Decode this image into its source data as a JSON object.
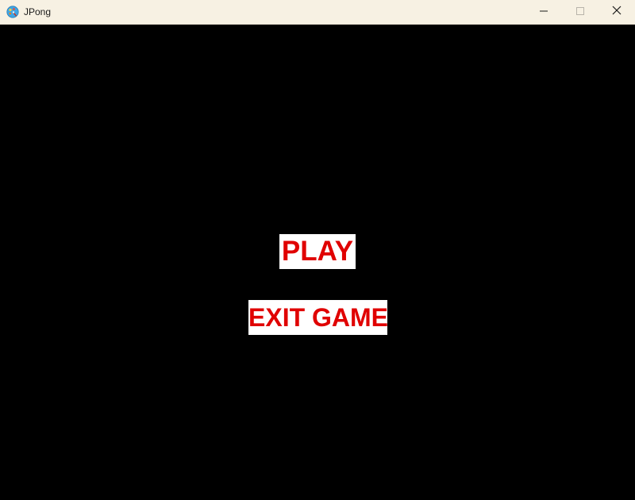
{
  "window": {
    "title": "JPong",
    "app_icon": "paint-palette-icon",
    "controls": {
      "minimize_icon": "minimize-icon",
      "maximize_icon": "maximize-icon",
      "close_icon": "close-icon"
    }
  },
  "menu": {
    "play_label": "PLAY",
    "exit_label": "EXIT GAME"
  },
  "colors": {
    "titlebar_bg": "#f7f1e3",
    "game_bg": "#000000",
    "button_bg": "#ffffff",
    "button_text": "#e00000"
  }
}
